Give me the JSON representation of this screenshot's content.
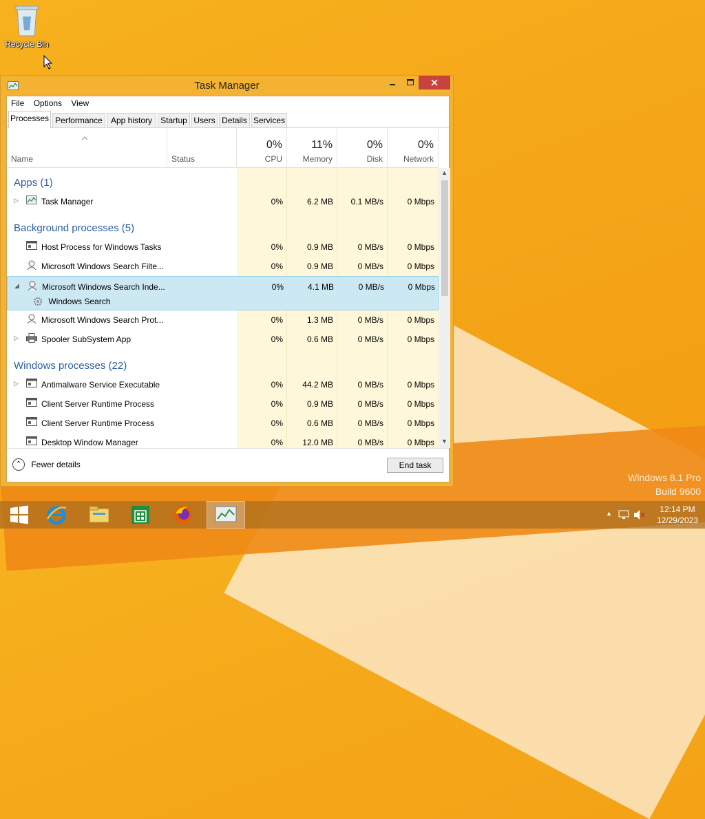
{
  "desktop": {
    "recycle_bin_label": "Recycle Bin",
    "watermark_line1": "Windows 8.1 Pro",
    "watermark_line2": "Build 9600"
  },
  "window": {
    "title": "Task Manager",
    "menu": [
      "File",
      "Options",
      "View"
    ],
    "tabs": [
      "Processes",
      "Performance",
      "App history",
      "Startup",
      "Users",
      "Details",
      "Services"
    ],
    "active_tab": "Processes"
  },
  "columns": {
    "name": "Name",
    "status": "Status",
    "cpu": {
      "pct": "0%",
      "label": "CPU"
    },
    "memory": {
      "pct": "11%",
      "label": "Memory"
    },
    "disk": {
      "pct": "0%",
      "label": "Disk"
    },
    "network": {
      "pct": "0%",
      "label": "Network"
    }
  },
  "groups": {
    "apps": "Apps (1)",
    "background": "Background processes (5)",
    "windows": "Windows processes (22)"
  },
  "processes": {
    "task_manager": {
      "name": "Task Manager",
      "cpu": "0%",
      "mem": "6.2 MB",
      "disk": "0.1 MB/s",
      "net": "0 Mbps"
    },
    "host_process": {
      "name": "Host Process for Windows Tasks",
      "cpu": "0%",
      "mem": "0.9 MB",
      "disk": "0 MB/s",
      "net": "0 Mbps"
    },
    "search_filter": {
      "name": "Microsoft Windows Search Filte...",
      "cpu": "0%",
      "mem": "0.9 MB",
      "disk": "0 MB/s",
      "net": "0 Mbps"
    },
    "search_indexer": {
      "name": "Microsoft Windows Search Inde...",
      "cpu": "0%",
      "mem": "4.1 MB",
      "disk": "0 MB/s",
      "net": "0 Mbps"
    },
    "windows_search": {
      "name": "Windows Search"
    },
    "search_protocol": {
      "name": "Microsoft Windows Search Prot...",
      "cpu": "0%",
      "mem": "1.3 MB",
      "disk": "0 MB/s",
      "net": "0 Mbps"
    },
    "spooler": {
      "name": "Spooler SubSystem App",
      "cpu": "0%",
      "mem": "0.6 MB",
      "disk": "0 MB/s",
      "net": "0 Mbps"
    },
    "antimalware": {
      "name": "Antimalware Service Executable",
      "cpu": "0%",
      "mem": "44.2 MB",
      "disk": "0 MB/s",
      "net": "0 Mbps"
    },
    "csrss1": {
      "name": "Client Server Runtime Process",
      "cpu": "0%",
      "mem": "0.9 MB",
      "disk": "0 MB/s",
      "net": "0 Mbps"
    },
    "csrss2": {
      "name": "Client Server Runtime Process",
      "cpu": "0%",
      "mem": "0.6 MB",
      "disk": "0 MB/s",
      "net": "0 Mbps"
    },
    "dwm": {
      "name": "Desktop Window Manager",
      "cpu": "0%",
      "mem": "12.0 MB",
      "disk": "0 MB/s",
      "net": "0 Mbps"
    }
  },
  "footer": {
    "fewer_details": "Fewer details",
    "end_task": "End task"
  },
  "taskbar": {
    "time": "12:14 PM",
    "date": "12/29/2023"
  },
  "colors": {
    "accent_window": "#f4b233",
    "close_button": "#c7433b",
    "group_text": "#2a5fa3",
    "selection": "#cce8f3",
    "heat_column": "#fff7d9"
  }
}
